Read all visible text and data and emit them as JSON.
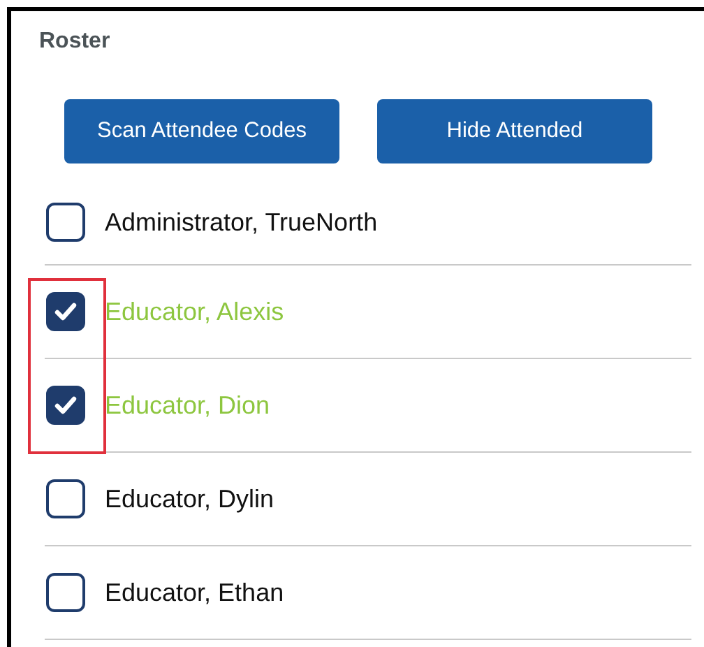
{
  "panel": {
    "title": "Roster"
  },
  "buttons": [
    "Scan Attendee Codes",
    "Hide Attended"
  ],
  "roster": [
    {
      "name": "Administrator, TrueNorth",
      "checked": false,
      "highlighted": false
    },
    {
      "name": "Educator, Alexis",
      "checked": true,
      "highlighted": true
    },
    {
      "name": "Educator, Dion",
      "checked": true,
      "highlighted": true
    },
    {
      "name": "Educator, Dylin",
      "checked": false,
      "highlighted": false
    },
    {
      "name": "Educator, Ethan",
      "checked": false,
      "highlighted": false
    }
  ]
}
